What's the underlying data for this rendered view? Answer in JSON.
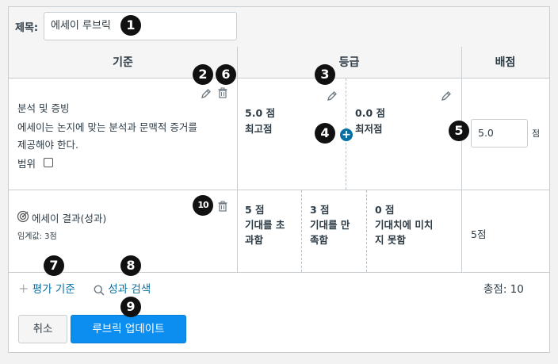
{
  "title_row": {
    "label": "제목:",
    "value": "에세이 루브릭"
  },
  "headers": {
    "criteria": "기준",
    "ratings": "등급",
    "points": "배점"
  },
  "criterion_1": {
    "name": "분석 및 증빙",
    "description_line1": "에세이는 논지에 맞는 분석과 문맥적 증거를",
    "description_line2": "제공해야 한다.",
    "range_label": "범위",
    "ratings": [
      {
        "points": "5.0 점",
        "label": "최고점"
      },
      {
        "points": "0.0 점",
        "label": "최저점"
      }
    ],
    "points_value": "5.0",
    "points_unit": "점"
  },
  "criterion_2": {
    "name": "에세이 결과(성과)",
    "threshold": "임계값: 3점",
    "ratings": [
      {
        "points": "5 점",
        "line1": "기대를 초",
        "line2": "과함"
      },
      {
        "points": "3 점",
        "line1": "기대를 만",
        "line2": "족함"
      },
      {
        "points": "0 점",
        "line1": "기대치에 미치",
        "line2": "지 못함"
      }
    ],
    "points": "5점"
  },
  "footer": {
    "add_criterion": "평가 기준",
    "find_outcome": "성과 검색",
    "total": "총점: 10"
  },
  "buttons": {
    "cancel": "취소",
    "update": "루브릭 업데이트"
  },
  "callouts": [
    "1",
    "2",
    "3",
    "4",
    "5",
    "6",
    "7",
    "8",
    "9",
    "10"
  ],
  "colors": {
    "accent": "#0770a3",
    "primary_button": "#0b8ef0",
    "border": "#c7cdd1",
    "callout": "#111111"
  }
}
